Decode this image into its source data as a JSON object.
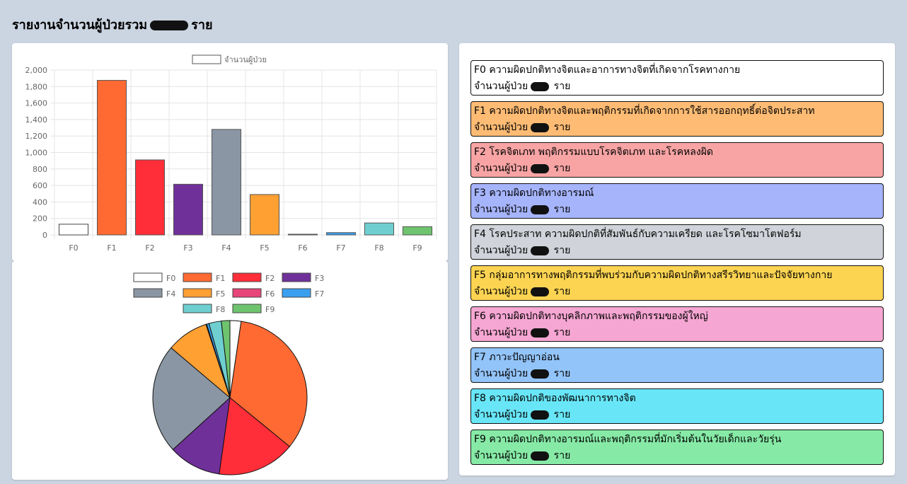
{
  "title_prefix": "รายงานจำนวนผู้ป่วยรวม",
  "title_suffix": "ราย",
  "chart_data": [
    {
      "type": "bar",
      "legend": "จำนวนผู้ป่วย",
      "categories": [
        "F0",
        "F1",
        "F2",
        "F3",
        "F4",
        "F5",
        "F6",
        "F7",
        "F8",
        "F9"
      ],
      "values": [
        130,
        1875,
        910,
        615,
        1280,
        490,
        8,
        28,
        145,
        100
      ],
      "ylim": [
        0,
        2000
      ],
      "yticks": [
        "0",
        "200",
        "400",
        "600",
        "800",
        "1,000",
        "1,200",
        "1,400",
        "1,600",
        "1,800",
        "2,000"
      ],
      "grid": true,
      "legend_position": "top"
    },
    {
      "type": "pie",
      "categories": [
        "F0",
        "F1",
        "F2",
        "F3",
        "F4",
        "F5",
        "F6",
        "F7",
        "F8",
        "F9"
      ],
      "values": [
        130,
        1875,
        910,
        615,
        1280,
        490,
        8,
        28,
        145,
        100
      ],
      "legend_position": "top"
    }
  ],
  "colors": {
    "fills": [
      "#ffffff",
      "#ff6a33",
      "#ff2e38",
      "#70309a",
      "#8a96a3",
      "#ffa033",
      "#e8457a",
      "#3b9ff0",
      "#6fcfd0",
      "#6ec46e"
    ],
    "item_bg": [
      "#ffffff",
      "#fdbb74",
      "#f8a4a4",
      "#a6b4fb",
      "#d0d4da",
      "#fcd452",
      "#f6a6d2",
      "#93c4f9",
      "#68e6f7",
      "#86eaa6"
    ]
  },
  "items": [
    {
      "code_title": "F0 ความผิดปกติทางจิตและอาการทางจิตที่เกิดจากโรคทางกาย",
      "count_label": "จำนวนผู้ป่วย",
      "unit": "ราย"
    },
    {
      "code_title": "F1 ความผิดปกติทางจิตและพฤติกรรมที่เกิดจากการใช้สารออกฤทธิ์ต่อจิตประสาท",
      "count_label": "จำนวนผู้ป่วย",
      "unit": "ราย"
    },
    {
      "code_title": "F2 โรคจิตเภท พฤติกรรมแบบโรคจิตเภท และโรคหลงผิด",
      "count_label": "จำนวนผู้ป่วย",
      "unit": "ราย"
    },
    {
      "code_title": "F3 ความผิดปกติทางอารมณ์",
      "count_label": "จำนวนผู้ป่วย",
      "unit": "ราย"
    },
    {
      "code_title": "F4 โรคประสาท ความผิดปกติที่สัมพันธ์กับความเครียด และโรคโซมาโตฟอร์ม",
      "count_label": "จำนวนผู้ป่วย",
      "unit": "ราย"
    },
    {
      "code_title": "F5 กลุ่มอาการทางพฤติกรรมที่พบร่วมกับความผิดปกติทางสรีรวิทยาและปัจจัยทางกาย",
      "count_label": "จำนวนผู้ป่วย",
      "unit": "ราย"
    },
    {
      "code_title": "F6 ความผิดปกติทางบุคลิกภาพและพฤติกรรมของผู้ใหญ่",
      "count_label": "จำนวนผู้ป่วย",
      "unit": "ราย"
    },
    {
      "code_title": "F7 ภาวะปัญญาอ่อน",
      "count_label": "จำนวนผู้ป่วย",
      "unit": "ราย"
    },
    {
      "code_title": "F8 ความผิดปกติของพัฒนาการทางจิต",
      "count_label": "จำนวนผู้ป่วย",
      "unit": "ราย"
    },
    {
      "code_title": "F9 ความผิดปกติทางอารมณ์และพฤติกรรมที่มักเริ่มต้นในวัยเด็กและวัยรุ่น",
      "count_label": "จำนวนผู้ป่วย",
      "unit": "ราย"
    }
  ]
}
